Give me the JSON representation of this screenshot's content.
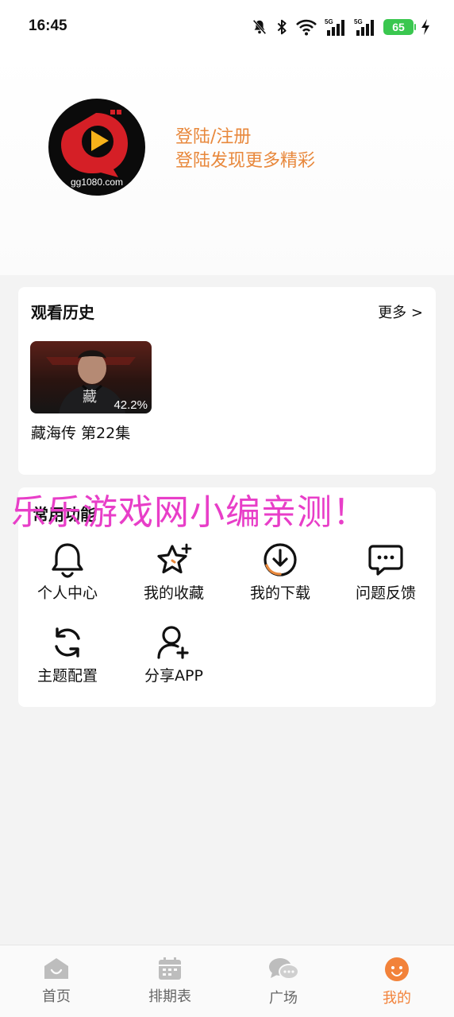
{
  "status_bar": {
    "time": "16:45",
    "battery": "65",
    "icons": [
      "mute-icon",
      "bluetooth-icon",
      "wifi-icon",
      "signal-5g-icon",
      "signal-5g-icon",
      "battery-icon",
      "charging-icon"
    ],
    "network_label": "5G"
  },
  "profile": {
    "avatar_text": "gg1080.com",
    "login_title": "登陆/注册",
    "login_subtitle": "登陆发现更多精彩",
    "accent_color": "#e8883c"
  },
  "history": {
    "title": "观看历史",
    "more": "更多 >",
    "items": [
      {
        "name": "藏海传 第22集",
        "progress": "42.2%"
      }
    ]
  },
  "functions": {
    "title": "常用功能",
    "items": [
      {
        "label": "个人中心",
        "icon": "bell-icon"
      },
      {
        "label": "我的收藏",
        "icon": "star-icon"
      },
      {
        "label": "我的下载",
        "icon": "download-icon"
      },
      {
        "label": "问题反馈",
        "icon": "chat-icon"
      },
      {
        "label": "主题配置",
        "icon": "refresh-icon"
      },
      {
        "label": "分享APP",
        "icon": "add-user-icon"
      }
    ]
  },
  "watermark": "乐乐游戏网小编亲测！",
  "bottom_nav": {
    "active_color": "#f2823a",
    "items": [
      {
        "label": "首页",
        "icon": "home-icon"
      },
      {
        "label": "排期表",
        "icon": "calendar-icon"
      },
      {
        "label": "广场",
        "icon": "chat-bubbles-icon"
      },
      {
        "label": "我的",
        "icon": "profile-icon"
      }
    ]
  }
}
